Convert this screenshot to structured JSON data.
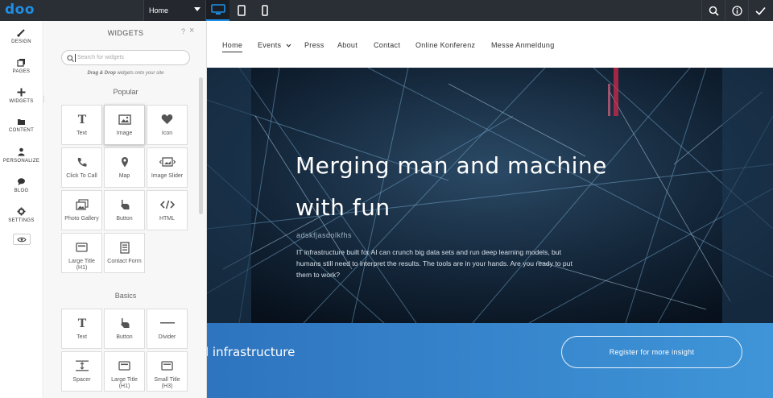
{
  "topbar": {
    "logo": "doo",
    "page_select": "Home",
    "devices": [
      "desktop-icon",
      "tablet-icon",
      "mobile-icon"
    ],
    "right_icons": [
      "search-icon",
      "info-icon",
      "check-icon"
    ],
    "accent": "#1e8fe6"
  },
  "rail": {
    "items": [
      {
        "label": "DESIGN",
        "icon": "brush-icon"
      },
      {
        "label": "PAGES",
        "icon": "pages-icon"
      },
      {
        "label": "WIDGETS",
        "icon": "plus-icon"
      },
      {
        "label": "CONTENT",
        "icon": "folder-icon"
      },
      {
        "label": "PERSONALIZE",
        "icon": "person-icon"
      },
      {
        "label": "BLOG",
        "icon": "chat-icon"
      },
      {
        "label": "SETTINGS",
        "icon": "gear-icon"
      }
    ],
    "active": "WIDGETS"
  },
  "panel": {
    "title": "WIDGETS",
    "help": "?",
    "close": "×",
    "search_placeholder": "Search for widgets",
    "hint_bold": "Drag & Drop",
    "hint_rest": " widgets onto your site",
    "popular_title": "Popular",
    "popular": [
      "Text",
      "Image",
      "Icon",
      "Click To Call",
      "Map",
      "Image Slider",
      "Photo Gallery",
      "Button",
      "HTML",
      "Large Title (H1)",
      "Contact Form"
    ],
    "basics_title": "Basics",
    "basics": [
      "Text",
      "Button",
      "Divider",
      "Spacer",
      "Large Title (H1)",
      "Small Title (H3)"
    ]
  },
  "site": {
    "nav": [
      "Home",
      "Events",
      "Press",
      "About",
      "Contact",
      "Online Konferenz",
      "Messe Anmeldung"
    ],
    "hero_title_1": "Merging man and machine",
    "hero_title_2": "with fun",
    "hero_sub": "adskfjasdolkfhs",
    "hero_body": "IT infrastructure built for AI can crunch big data sets and run deep learning models, but humans still need to interpret the results. The tools are in your hands. Are you ready to put them to work?",
    "band_text": "l infrastructure",
    "band_button": "Register for more insight"
  }
}
